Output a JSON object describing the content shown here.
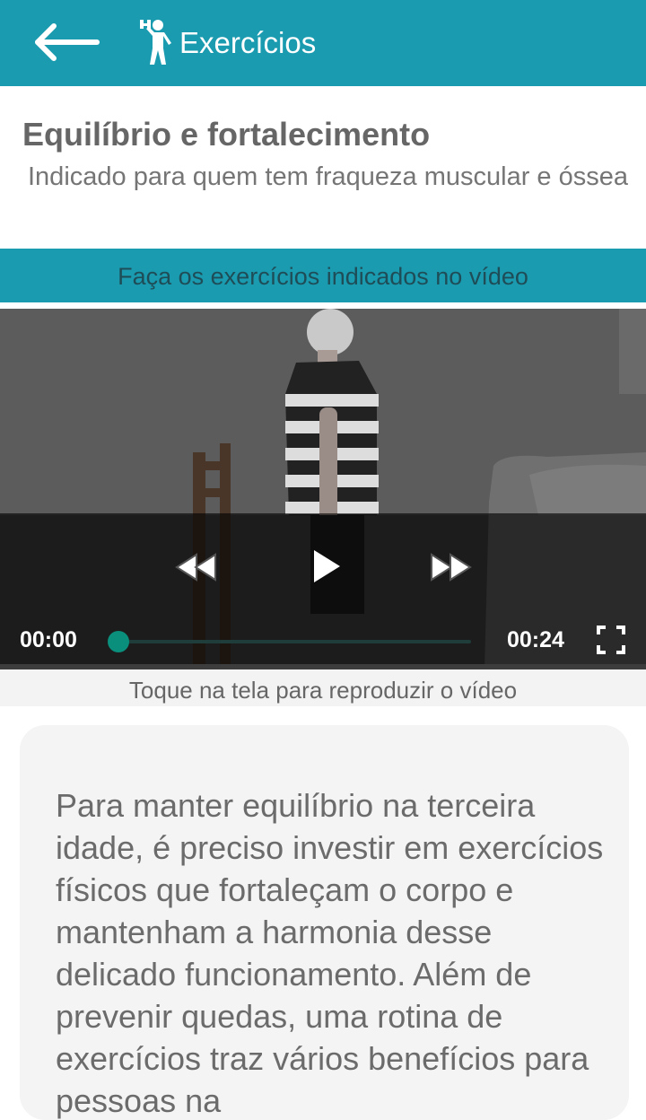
{
  "appbar": {
    "title": "Exercícios",
    "back_icon": "arrow-left-icon",
    "title_icon": "person-dumbbell-icon",
    "color": "#1a9bb0"
  },
  "content": {
    "heading": "Equilíbrio e fortalecimento",
    "subheading": "Indicado para quem tem fraqueza muscular e óssea",
    "banner": "Faça os exercícios indicados no vídeo"
  },
  "video": {
    "current_time": "00:00",
    "duration": "00:24",
    "progress": 0,
    "rewind_icon": "rewind-icon",
    "play_icon": "play-icon",
    "forward_icon": "fast-forward-icon",
    "fullscreen_icon": "fullscreen-icon"
  },
  "hint": "Toque na tela para reproduzir o vídeo",
  "description": "Para manter equilíbrio na terceira idade, é preciso investir em exercícios físicos que fortaleçam o corpo e mantenham a harmonia desse delicado funcionamento. Além de prevenir quedas, uma rotina de exercícios traz vários benefícios para pessoas na"
}
